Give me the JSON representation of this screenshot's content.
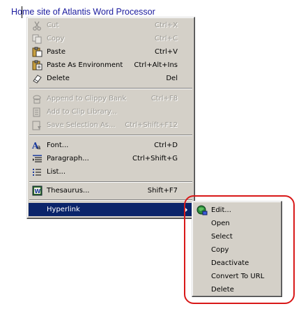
{
  "document": {
    "text": "Home site of Atlantis Word Processor"
  },
  "context_menu": {
    "items": [
      {
        "label": "Cut",
        "shortcut": "Ctrl+X",
        "icon": "scissors-icon",
        "disabled": true
      },
      {
        "label": "Copy",
        "shortcut": "Ctrl+C",
        "icon": "copy-icon",
        "disabled": true
      },
      {
        "label": "Paste",
        "shortcut": "Ctrl+V",
        "icon": "paste-icon",
        "disabled": false
      },
      {
        "label": "Paste As Environment",
        "shortcut": "Ctrl+Alt+Ins",
        "icon": "paste-environment-icon",
        "disabled": false
      },
      {
        "label": "Delete",
        "shortcut": "Del",
        "icon": "eraser-icon",
        "disabled": false
      },
      {
        "label": "Append to Clippy Bank",
        "shortcut": "Ctrl+F8",
        "icon": "clippy-bank-icon",
        "disabled": true
      },
      {
        "label": "Add to Clip Library...",
        "shortcut": "",
        "icon": "clip-library-icon",
        "disabled": true
      },
      {
        "label": "Save Selection As...",
        "shortcut": "Ctrl+Shift+F12",
        "icon": "save-selection-icon",
        "disabled": true
      },
      {
        "label": "Font...",
        "shortcut": "Ctrl+D",
        "icon": "font-icon",
        "disabled": false
      },
      {
        "label": "Paragraph...",
        "shortcut": "Ctrl+Shift+G",
        "icon": "paragraph-icon",
        "disabled": false
      },
      {
        "label": "List...",
        "shortcut": "",
        "icon": "list-icon",
        "disabled": false
      },
      {
        "label": "Thesaurus...",
        "shortcut": "Shift+F7",
        "icon": "thesaurus-icon",
        "disabled": false
      },
      {
        "label": "Hyperlink",
        "shortcut": "",
        "icon": "",
        "disabled": false
      }
    ]
  },
  "submenu": {
    "items": [
      {
        "label": "Edit...",
        "icon": "globe-edit-icon"
      },
      {
        "label": "Open",
        "icon": ""
      },
      {
        "label": "Select",
        "icon": ""
      },
      {
        "label": "Copy",
        "icon": ""
      },
      {
        "label": "Deactivate",
        "icon": ""
      },
      {
        "label": "Convert To URL",
        "icon": ""
      },
      {
        "label": "Delete",
        "icon": ""
      }
    ]
  },
  "colors": {
    "menu_bg": "#d4d0c8",
    "highlight": "#0a246a",
    "annotation_ring": "#d81818",
    "doc_text": "#1a1a9e"
  }
}
